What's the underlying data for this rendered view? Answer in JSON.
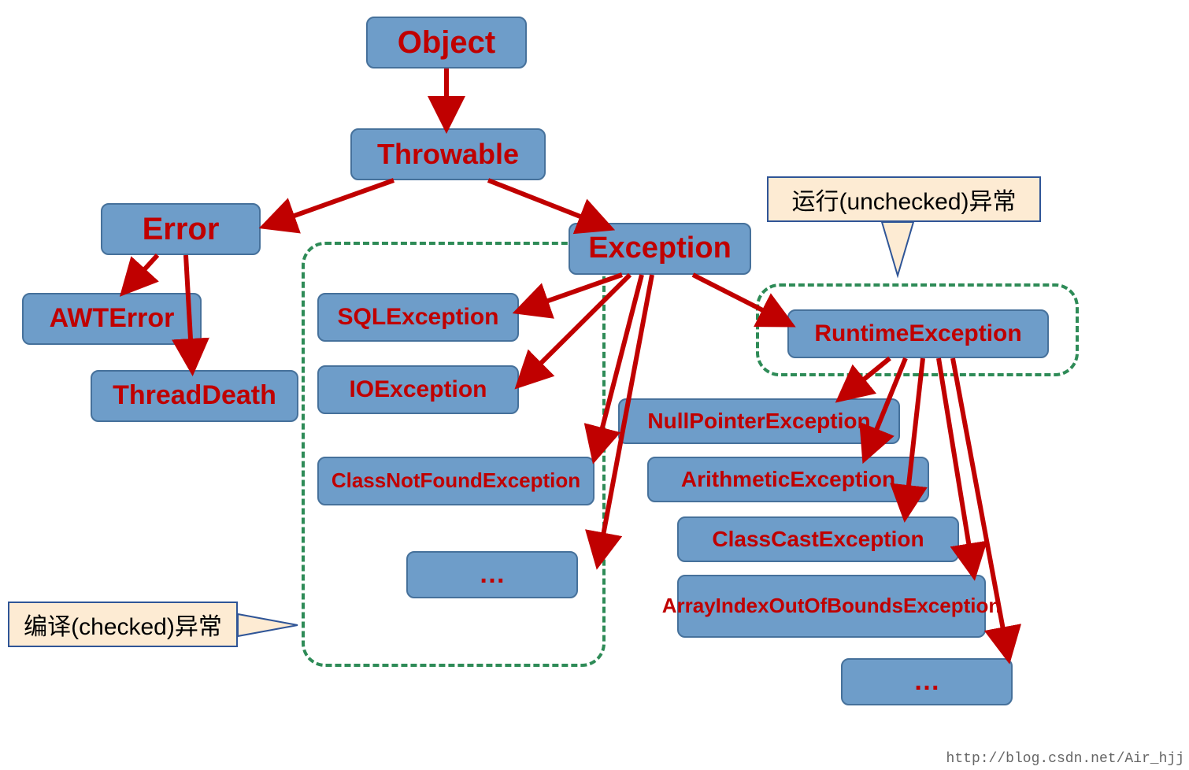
{
  "nodes": {
    "object": "Object",
    "throwable": "Throwable",
    "error": "Error",
    "awterror": "AWTError",
    "threaddeath": "ThreadDeath",
    "exception": "Exception",
    "sqlexception": "SQLException",
    "ioexception": "IOException",
    "classnotfound": "ClassNotFoundException",
    "ellipsis1": "…",
    "runtimeexception": "RuntimeException",
    "nullpointer": "NullPointerException",
    "arithmetic": "ArithmeticException",
    "classcast": "ClassCastException",
    "arrayindex": "ArrayIndexOutOfBoundsException",
    "ellipsis2": "…"
  },
  "callouts": {
    "unchecked": "运行(unchecked)异常",
    "checked": "编译(checked)异常"
  },
  "watermark": "http://blog.csdn.net/Air_hjj",
  "colors": {
    "node_bg": "#6e9dc9",
    "node_border": "#46719b",
    "text": "#c00000",
    "arrow": "#c00000",
    "dashed": "#2e8b57",
    "callout_bg": "#fdebd3",
    "callout_border": "#2f5597"
  }
}
